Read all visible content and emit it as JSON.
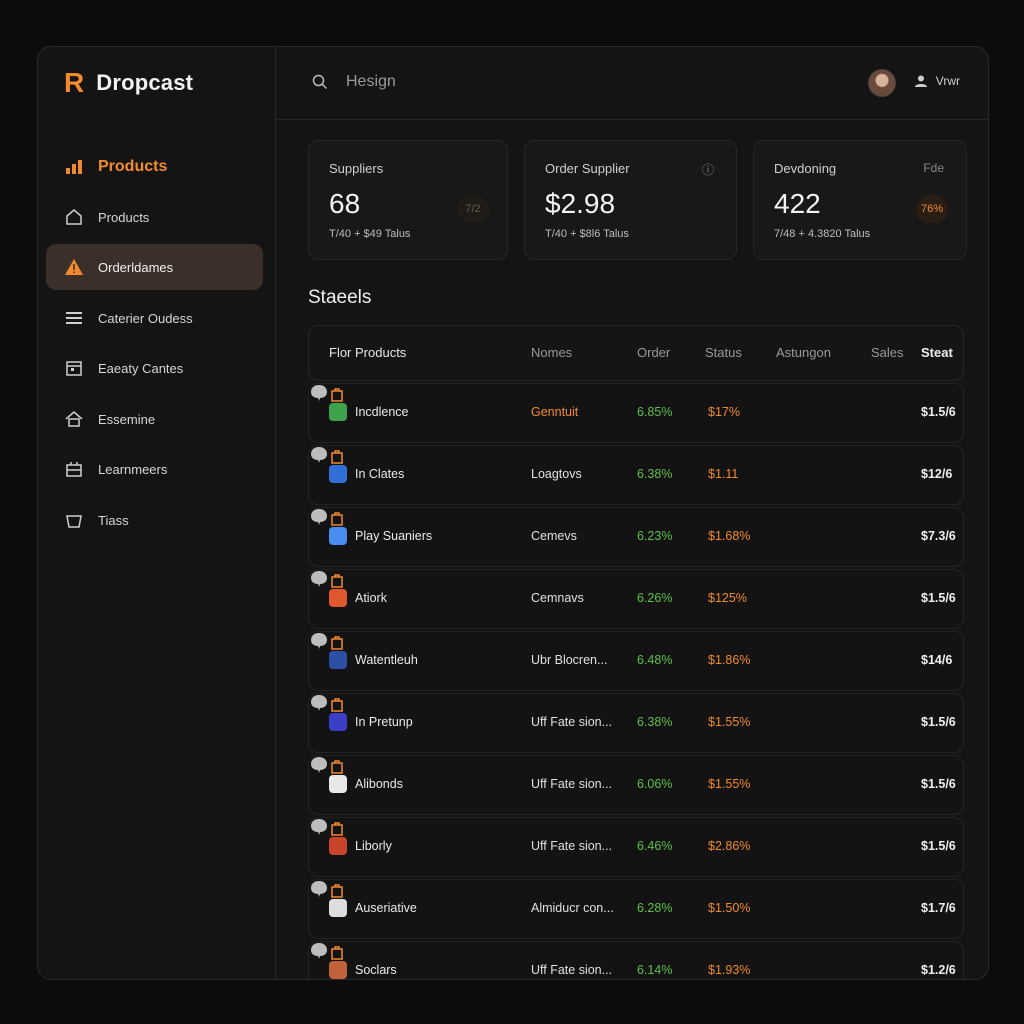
{
  "app": {
    "logo": "R",
    "name": "Dropcast"
  },
  "sidebar": {
    "items": [
      {
        "label": "Products",
        "icon": "bar-chart-icon"
      },
      {
        "label": "Products",
        "icon": "home-icon"
      },
      {
        "label": "Orderldames",
        "icon": "warning-icon"
      },
      {
        "label": "Caterier Oudess",
        "icon": "menu-lines-icon"
      },
      {
        "label": "Eaeaty Cantes",
        "icon": "calendar-icon"
      },
      {
        "label": "Essemine",
        "icon": "house-icon"
      },
      {
        "label": "Learnmeers",
        "icon": "crate-icon"
      },
      {
        "label": "Tiass",
        "icon": "basket-icon"
      }
    ]
  },
  "topbar": {
    "search_placeholder": "Hesign",
    "user_label": "Vrwr"
  },
  "cards": [
    {
      "title": "Suppliers",
      "value": "68",
      "sub": "T/40 + $49 Talus",
      "badge": "7/2",
      "corner": ""
    },
    {
      "title": "Order Supplier",
      "value": "$2.98",
      "sub": "T/40 + $8l6 Talus",
      "badge": "",
      "corner": "ⓘ"
    },
    {
      "title": "Devdoning",
      "value": "422",
      "sub": "7/48 + 4.3820 Talus",
      "badge": "76%",
      "corner": "Fde"
    }
  ],
  "section_title": "Staeels",
  "table": {
    "headers": [
      "Flor Products",
      "Nomes",
      "Order",
      "Status",
      "Astungon",
      "Sales",
      "Steat"
    ],
    "rows": [
      {
        "name": "Incdlence",
        "supplier": "Genntuit",
        "order": "6.85%",
        "status": "$17%",
        "price": "$1.5/6",
        "icon_color": "#3fa34d",
        "supplier_color": "#f28a2e"
      },
      {
        "name": "In Clates",
        "supplier": "Loagtovs",
        "order": "6.38%",
        "status": "$1.11",
        "price": "$12/6",
        "icon_color": "#2f6fd6",
        "supplier_color": "#e0e0e0"
      },
      {
        "name": "Play Suaniers",
        "supplier": "Cemevs",
        "order": "6.23%",
        "status": "$1.68%",
        "price": "$7.3/6",
        "icon_color": "#4a8cf0",
        "supplier_color": "#e0e0e0"
      },
      {
        "name": "Atiork",
        "supplier": "Cemnavs",
        "order": "6.26%",
        "status": "$125%",
        "price": "$1.5/6",
        "icon_color": "#e0582e",
        "supplier_color": "#e0e0e0"
      },
      {
        "name": "Watentleuh",
        "supplier": "Ubr Blocren...",
        "order": "6.48%",
        "status": "$1.86%",
        "price": "$14/6",
        "icon_color": "#2e4fa8",
        "supplier_color": "#e0e0e0"
      },
      {
        "name": "In Pretunp",
        "supplier": "Uff Fate sion...",
        "order": "6.38%",
        "status": "$1.55%",
        "price": "$1.5/6",
        "icon_color": "#3b3ec7",
        "supplier_color": "#e0e0e0"
      },
      {
        "name": "Alibonds",
        "supplier": "Uff Fate sion...",
        "order": "6.06%",
        "status": "$1.55%",
        "price": "$1.5/6",
        "icon_color": "#e8e8e8",
        "supplier_color": "#e0e0e0"
      },
      {
        "name": "Liborly",
        "supplier": "Uff Fate sion...",
        "order": "6.46%",
        "status": "$2.86%",
        "price": "$1.5/6",
        "icon_color": "#c8452c",
        "supplier_color": "#e0e0e0"
      },
      {
        "name": "Auseriative",
        "supplier": "Almiducr con...",
        "order": "6.28%",
        "status": "$1.50%",
        "price": "$1.7/6",
        "icon_color": "#dddddd",
        "supplier_color": "#e0e0e0"
      },
      {
        "name": "Soclars",
        "supplier": "Uff Fate sion...",
        "order": "6.14%",
        "status": "$1.93%",
        "price": "$1.2/6",
        "icon_color": "#c0623a",
        "supplier_color": "#e0e0e0"
      }
    ]
  },
  "colors": {
    "accent": "#f28a2e",
    "positive": "#5fbf4a",
    "selected_bg": "#3b3029"
  }
}
